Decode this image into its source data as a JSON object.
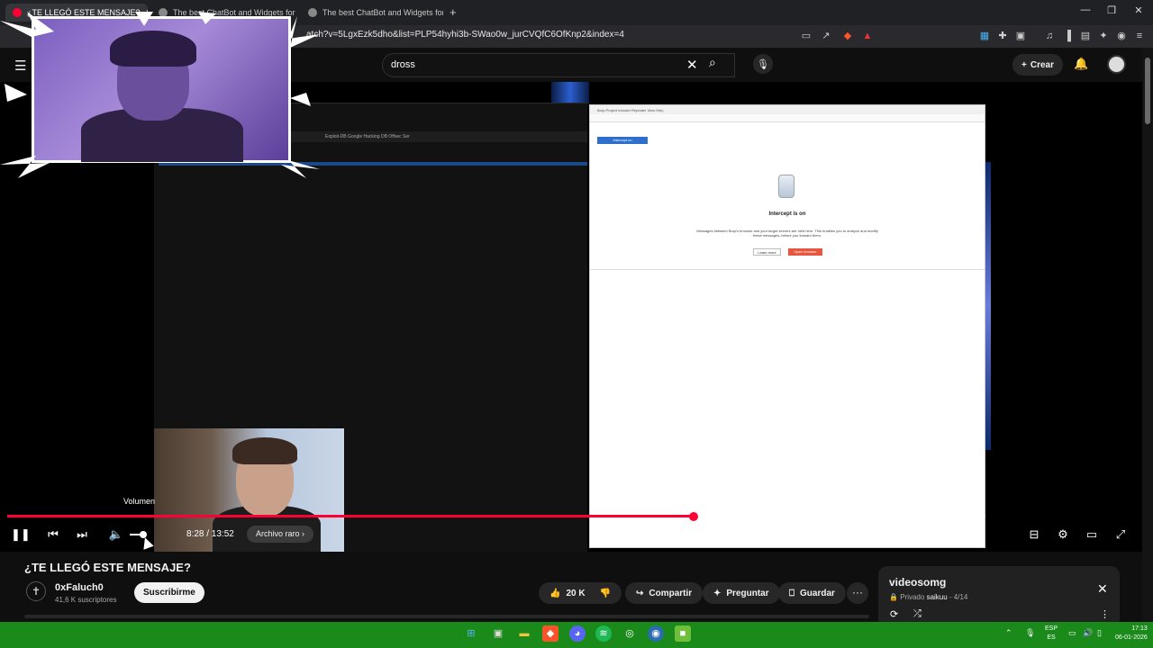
{
  "browser": {
    "tabs": [
      {
        "label": "¿TE LLEGÓ ESTE MENSAJE?",
        "active": true
      },
      {
        "label": "The best ChatBot and Widgets for K",
        "active": false
      },
      {
        "label": "The best ChatBot and Widgets for Ki",
        "active": false
      }
    ],
    "new_tab": "+",
    "url": "atch?v=5LgxEzk5dho&list=PLP54hyhi3b-SWao0w_jurCVQfC6OfKnp2&index=4"
  },
  "header": {
    "search_value": "dross",
    "create_label": "Crear"
  },
  "video_content": {
    "left_bar_text": "Exploit-DB   Google Hacking DB   Offsec   Ser",
    "burp_menu": "Burp  Project  Intruder  Repeater  View  Help",
    "burp_intercept_button": "Intercept on",
    "burp_title": "Intercept is on",
    "burp_description": "Messages between Burp's browser and your target servers are held here. This enables you to analyze and modify these messages, before you forward them.",
    "burp_learn": "Learn more",
    "burp_open": "Open browser"
  },
  "player": {
    "progress_fraction": 0.702,
    "volume_tooltip": "Volumen",
    "time": "8:28 / 13:52",
    "chapter": "Archivo raro",
    "chapter_arrow": "›"
  },
  "info": {
    "title": "¿TE LLEGÓ ESTE MENSAJE?",
    "channel_name": "0xFaluch0",
    "subscribers": "41,6 K suscriptores",
    "subscribe_label": "Suscribirme",
    "likes": "20 K",
    "share_label": "Compartir",
    "ask_label": "Preguntar",
    "save_label": "Guardar",
    "more_label": "···"
  },
  "playlist": {
    "title": "videosomg",
    "privacy": "Privado",
    "owner": "saikuu",
    "position": "- 4/14"
  },
  "taskbar": {
    "lang_top": "ESP",
    "lang_bottom": "ES",
    "time": "17:13",
    "date": "06-01-2026"
  },
  "colors": {
    "accent_red": "#ff0033",
    "taskbar_green": "#1a8a1a",
    "burp_orange": "#e8553e"
  }
}
